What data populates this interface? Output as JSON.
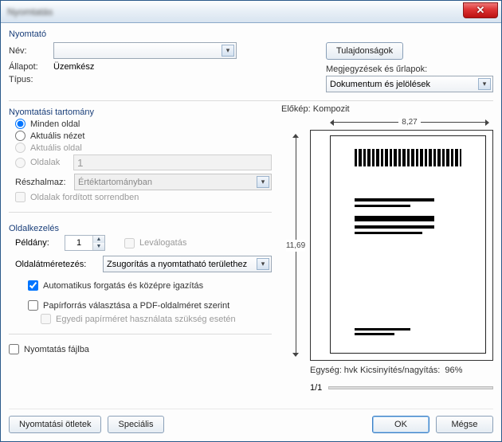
{
  "window": {
    "title": "Nyomtatás"
  },
  "printer": {
    "section_label": "Nyomtató",
    "name_label": "Név:",
    "name_value": "",
    "status_label": "Állapot:",
    "status_value": "Üzemkész",
    "type_label": "Típus:",
    "type_value": "",
    "properties_btn": "Tulajdonságok",
    "comments_label": "Megjegyzések és űrlapok:",
    "comments_value": "Dokumentum és jelölések"
  },
  "range": {
    "section_label": "Nyomtatási tartomány",
    "all_pages": "Minden oldal",
    "current_view": "Aktuális nézet",
    "current_page": "Aktuális oldal",
    "pages_label": "Oldalak",
    "pages_value": "1",
    "subset_label": "Részhalmaz:",
    "subset_value": "Értéktartományban",
    "reverse_label": "Oldalak fordított sorrendben"
  },
  "handling": {
    "section_label": "Oldalkezelés",
    "copies_label": "Példány:",
    "copies_value": "1",
    "collate_label": "Leválogatás",
    "scaling_label": "Oldalátméretezés:",
    "scaling_value": "Zsugorítás a nyomtatható területhez",
    "autorotate_label": "Automatikus forgatás és középre igazítás",
    "papersource_label": "Papírforrás választása a PDF-oldalméret szerint",
    "custom_paper_label": "Egyedi papírméret használata szükség esetén"
  },
  "print_to_file": "Nyomtatás fájlba",
  "preview": {
    "label": "Előkép: Kompozit",
    "width": "8,27",
    "height": "11,69",
    "units_label": "Egység: hvk Kicsinyítés/nagyítás:",
    "zoom": "96%",
    "page_indicator": "1/1"
  },
  "buttons": {
    "tips": "Nyomtatási ötletek",
    "advanced": "Speciális",
    "ok": "OK",
    "cancel": "Mégse"
  }
}
